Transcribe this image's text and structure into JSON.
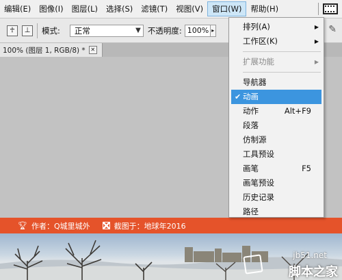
{
  "menubar": {
    "items": [
      {
        "label": "编辑(E)",
        "name": "menu-edit"
      },
      {
        "label": "图像(I)",
        "name": "menu-image"
      },
      {
        "label": "图层(L)",
        "name": "menu-layer"
      },
      {
        "label": "选择(S)",
        "name": "menu-select"
      },
      {
        "label": "滤镜(T)",
        "name": "menu-filter"
      },
      {
        "label": "视图(V)",
        "name": "menu-view"
      },
      {
        "label": "窗口(W)",
        "name": "menu-window",
        "active": true
      },
      {
        "label": "帮助(H)",
        "name": "menu-help"
      }
    ]
  },
  "options": {
    "mode_label": "模式:",
    "mode_value": "正常",
    "opacity_label": "不透明度:",
    "opacity_value": "100%"
  },
  "document_tab": {
    "title": "100% (图层 1, RGB/8) *",
    "close_glyph": "✕"
  },
  "window_menu": {
    "items": [
      {
        "label": "排列(A)",
        "submenu": true
      },
      {
        "label": "工作区(K)",
        "submenu": true
      },
      {
        "separator": true
      },
      {
        "label": "扩展功能",
        "submenu": true,
        "disabled": true
      },
      {
        "separator": true
      },
      {
        "label": "导航器"
      },
      {
        "label": "动画",
        "checked": true,
        "selected": true
      },
      {
        "label": "动作",
        "shortcut": "Alt+F9"
      },
      {
        "label": "段落"
      },
      {
        "label": "仿制源"
      },
      {
        "label": "工具预设"
      },
      {
        "label": "画笔",
        "shortcut": "F5"
      },
      {
        "label": "画笔预设"
      },
      {
        "label": "历史记录"
      },
      {
        "label": "路径"
      }
    ]
  },
  "banner": {
    "author": "作者：Q城里城外",
    "credit": "截图于：地球年2016",
    "color": "#e5532a"
  },
  "watermark": {
    "site": "jb51.net",
    "name": "脚本之家"
  },
  "colors": {
    "menu_highlight": "#3c95df",
    "menubar_bg": "#f0f0f0",
    "canvas_bg": "#c2c2c2"
  }
}
